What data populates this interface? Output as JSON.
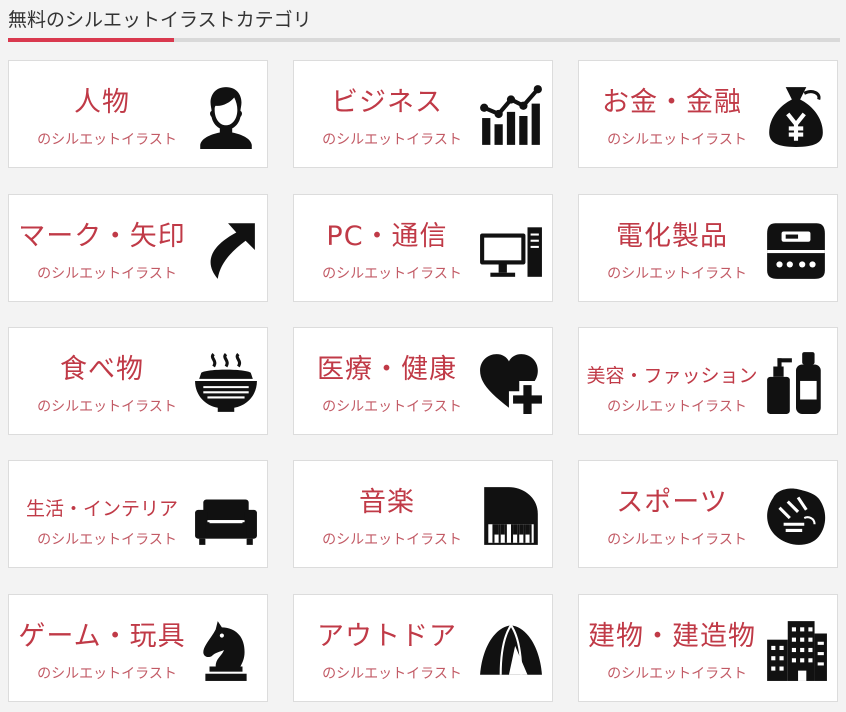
{
  "header": {
    "title": "無料のシルエットイラストカテゴリ"
  },
  "colors": {
    "accent": "#d9394e",
    "title": "#c03a47",
    "icon": "#111111"
  },
  "categories": [
    {
      "title": "人物",
      "subtitle": "のシルエットイラスト",
      "icon": "person-icon"
    },
    {
      "title": "ビジネス",
      "subtitle": "のシルエットイラスト",
      "icon": "business-chart-icon"
    },
    {
      "title": "お金・金融",
      "subtitle": "のシルエットイラスト",
      "icon": "money-bag-icon"
    },
    {
      "title": "マーク・矢印",
      "subtitle": "のシルエットイラスト",
      "icon": "arrow-icon"
    },
    {
      "title": "PC・通信",
      "subtitle": "のシルエットイラスト",
      "icon": "computer-icon"
    },
    {
      "title": "電化製品",
      "subtitle": "のシルエットイラスト",
      "icon": "rice-cooker-icon"
    },
    {
      "title": "食べ物",
      "subtitle": "のシルエットイラスト",
      "icon": "food-bowl-icon"
    },
    {
      "title": "医療・健康",
      "subtitle": "のシルエットイラスト",
      "icon": "heart-plus-icon"
    },
    {
      "title": "美容・ファッション",
      "subtitle": "のシルエットイラスト",
      "icon": "cosmetics-icon"
    },
    {
      "title": "生活・インテリア",
      "subtitle": "のシルエットイラスト",
      "icon": "sofa-icon"
    },
    {
      "title": "音楽",
      "subtitle": "のシルエットイラスト",
      "icon": "piano-icon"
    },
    {
      "title": "スポーツ",
      "subtitle": "のシルエットイラスト",
      "icon": "baseball-glove-icon"
    },
    {
      "title": "ゲーム・玩具",
      "subtitle": "のシルエットイラスト",
      "icon": "chess-knight-icon"
    },
    {
      "title": "アウトドア",
      "subtitle": "のシルエットイラスト",
      "icon": "tent-icon"
    },
    {
      "title": "建物・建造物",
      "subtitle": "のシルエットイラスト",
      "icon": "buildings-icon"
    }
  ]
}
